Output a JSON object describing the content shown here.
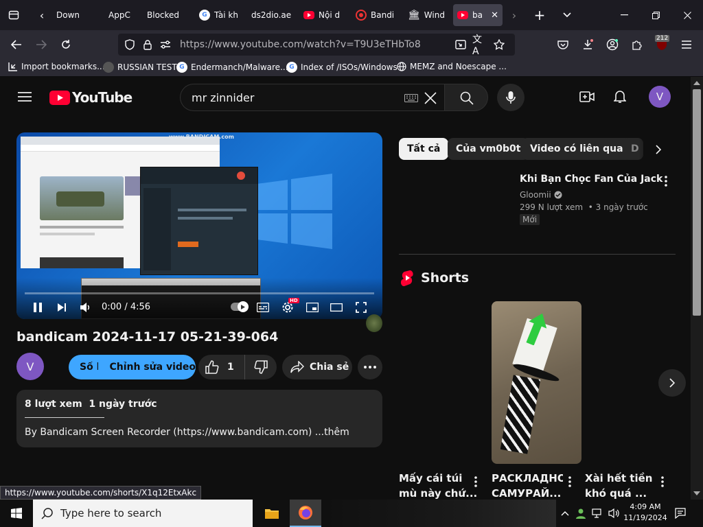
{
  "browser": {
    "tabs": [
      {
        "label": "Down"
      },
      {
        "label": "AppC"
      },
      {
        "label": "Blocked"
      },
      {
        "label": "Tài kh"
      },
      {
        "label": "ds2dio.ae"
      },
      {
        "label": "Nội d"
      },
      {
        "label": "Bandi"
      },
      {
        "label": "Wind"
      },
      {
        "label": "ba"
      }
    ],
    "url": "https://www.youtube.com/watch?v=T9U3eTHbTo8",
    "notification_count": "212",
    "bookmarks": [
      {
        "label": "Import bookmarks..."
      },
      {
        "label": "RUSSIAN TEST"
      },
      {
        "label": "Endermanch/Malware..."
      },
      {
        "label": "Index of /ISOs/Windows"
      },
      {
        "label": "MEMZ and Noescape ..."
      }
    ],
    "status_url": "https://www.youtube.com/shorts/X1q12EtxAkc"
  },
  "youtube": {
    "logo_text": "YouTube",
    "search_value": "mr zinnider",
    "avatar_letter": "V",
    "player": {
      "time": "0:00 / 4:56",
      "watermark": "www.BANDICAM.com",
      "progress": 0.0
    },
    "video_title": "bandicam 2024-11-17 05-21-39-064",
    "channel_avatar_letter": "V",
    "actions": {
      "stats_label": "Số liệu",
      "edit_label": "Chỉnh sửa video",
      "like_count": "1",
      "share_label": "Chia sẻ"
    },
    "description": {
      "stats": "8 lượt xem  1 ngày trước",
      "text": "By Bandicam Screen Recorder (https://www.bandicam.com) ...thêm"
    },
    "filter_chips": [
      {
        "label": "Tất cả"
      },
      {
        "label": "Của vm0b0t"
      },
      {
        "label": "Video có liên quan"
      },
      {
        "label": "D"
      }
    ],
    "recommended": {
      "title": "Khi Bạn Chọc Fan Của Jack",
      "channel": "Gloomii",
      "meta": "299 N lượt xem  • 3 ngày trước",
      "badge": "Mới"
    },
    "shorts": {
      "heading": "Shorts",
      "items": [
        {
          "title_1": "Mấy cái túi",
          "title_2": "mù này chứ..."
        },
        {
          "title_1": "РАСКЛАДНО",
          "title_2": "САМУРАЙ..."
        },
        {
          "title_1": "Xài hết tiền",
          "title_2": "khó quá ..."
        }
      ]
    }
  },
  "taskbar": {
    "search_placeholder": "Type here to search",
    "time": "4:09 AM",
    "date": "11/19/2024"
  },
  "colors": {
    "yt_red": "#ff0033",
    "chip_active": "#f1f1f1",
    "blue_button": "#3ea6ff",
    "avatar_purple": "#7e57c2"
  }
}
